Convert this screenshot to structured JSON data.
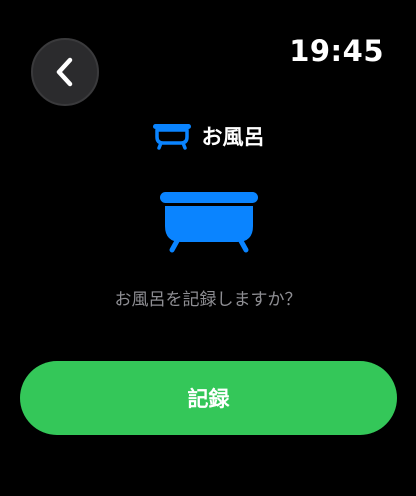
{
  "status": {
    "time": "19:45"
  },
  "nav": {
    "back_icon": "chevron-left-icon"
  },
  "header": {
    "icon": "bathtub-icon",
    "title": "お風呂"
  },
  "main": {
    "icon": "bathtub-icon",
    "prompt": "お風呂を記録しますか？"
  },
  "actions": {
    "record_label": "記録"
  },
  "colors": {
    "accent_blue": "#0a84ff",
    "button_green": "#34c759",
    "secondary_text": "#8e8e93",
    "background": "#000000"
  }
}
